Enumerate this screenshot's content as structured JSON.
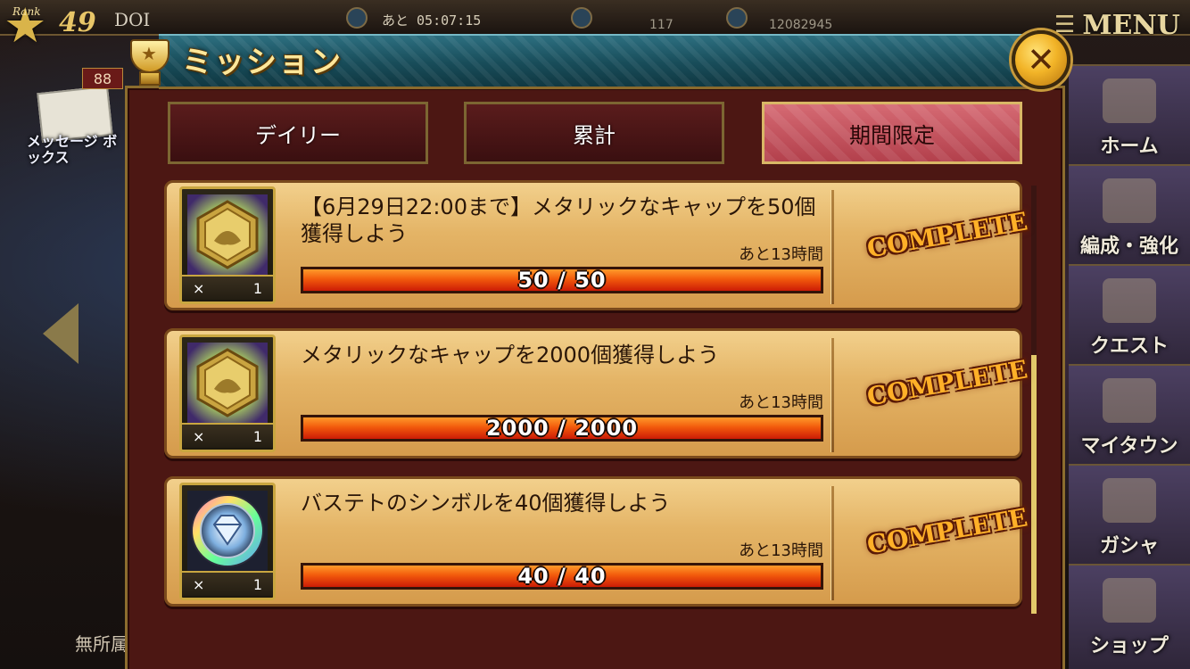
{
  "hud": {
    "rank_label": "Rank",
    "level": "49",
    "player_name": "DOI",
    "timer": "あと 05:07:15",
    "stat_a": "117",
    "stat_b": "12082945",
    "menu_label": "MENU",
    "message_count": "88",
    "message_box_label": "メッセージ ボックス",
    "affiliation": "無所属"
  },
  "side_menu": [
    {
      "label": "ホーム"
    },
    {
      "label": "編成・強化"
    },
    {
      "label": "クエスト"
    },
    {
      "label": "マイタウン"
    },
    {
      "label": "ガシャ"
    },
    {
      "label": "ショップ"
    }
  ],
  "dialog": {
    "title": "ミッション",
    "close_glyph": "✕"
  },
  "tabs": [
    {
      "label": "デイリー",
      "active": false
    },
    {
      "label": "累計",
      "active": false
    },
    {
      "label": "期間限定",
      "active": true
    }
  ],
  "missions": [
    {
      "reward_icon": "metallic-cap-badge-icon",
      "reward_x": "×",
      "reward_qty": "1",
      "title": "【6月29日22:00まで】メタリックなキャップを50個獲得しよう",
      "remaining": "あと13時間",
      "progress_text": "50 / 50",
      "progress": 1.0,
      "status": "COMPLETE"
    },
    {
      "reward_icon": "metallic-cap-badge-icon",
      "reward_x": "×",
      "reward_qty": "1",
      "title": "メタリックなキャップを2000個獲得しよう",
      "remaining": "あと13時間",
      "progress_text": "2000 / 2000",
      "progress": 1.0,
      "status": "COMPLETE"
    },
    {
      "reward_icon": "bastet-symbol-gem-icon",
      "reward_x": "×",
      "reward_qty": "1",
      "title": "バステトのシンボルを40個獲得しよう",
      "remaining": "あと13時間",
      "progress_text": "40 / 40",
      "progress": 1.0,
      "status": "COMPLETE"
    }
  ]
}
